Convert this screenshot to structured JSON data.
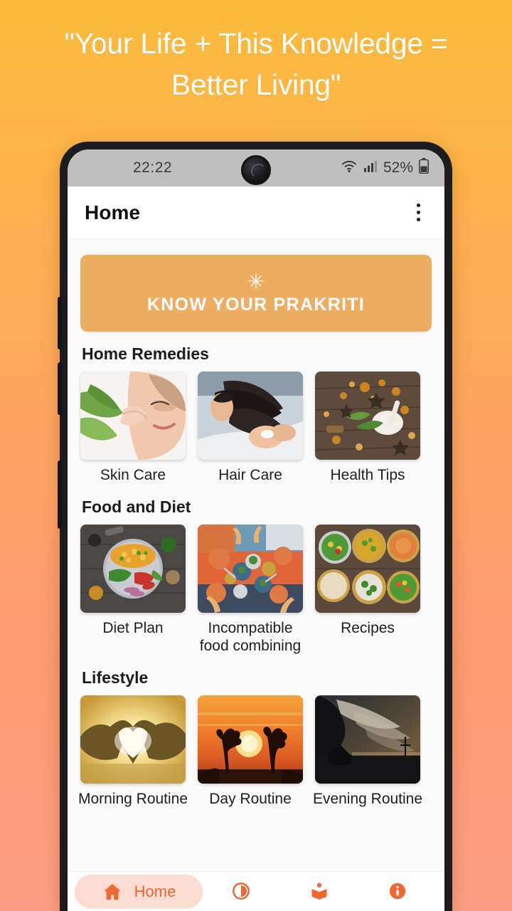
{
  "headline": "\"Your Life + This Knowledge = Better Living\"",
  "colors": {
    "bg_top": "#FCBB39",
    "bg_bottom": "#FC9E85",
    "accent": "#F1672F",
    "banner": "#EDAE62",
    "nav_pill": "#FBDCD0",
    "phone_frame": "#1D1D1F"
  },
  "status_bar": {
    "time": "22:22",
    "wifi_icon": "wifi-icon",
    "signal_icon": "cellular-signal-icon",
    "battery_percent": "52%",
    "battery_icon": "battery-icon",
    "camera": "front-camera"
  },
  "app_bar": {
    "title": "Home",
    "overflow_icon": "more-vert-icon"
  },
  "banner": {
    "icon": "asterisk-flower-icon",
    "glyph": "✳",
    "label": "KNOW YOUR PRAKRITI"
  },
  "sections": [
    {
      "title": "Home Remedies",
      "tiles": [
        {
          "label": "Skin Care",
          "image": "woman-applying-aloe-vera-skincare"
        },
        {
          "label": "Hair Care",
          "image": "woman-hair-wash-salon"
        },
        {
          "label": "Health Tips",
          "image": "herbs-spices-mortar-pestle"
        }
      ]
    },
    {
      "title": "Food and Diet",
      "tiles": [
        {
          "label": "Diet Plan",
          "image": "indian-thali-platter-top-view"
        },
        {
          "label": "Incompatible food combining",
          "image": "people-sharing-meal-table"
        },
        {
          "label": "Recipes",
          "image": "assorted-curry-bowls-wooden-table"
        }
      ]
    },
    {
      "title": "Lifestyle",
      "tiles": [
        {
          "label": "Morning Routine",
          "image": "hands-heart-shape-sunrise"
        },
        {
          "label": "Day Routine",
          "image": "sunset-trees-silhouette"
        },
        {
          "label": "Evening Routine",
          "image": "dusk-house-silhouette-clouds"
        }
      ]
    }
  ],
  "bottom_nav": [
    {
      "label": "Home",
      "icon": "home-icon",
      "active": true
    },
    {
      "label": "",
      "icon": "dosha-circle-icon",
      "active": false
    },
    {
      "label": "",
      "icon": "reading-book-icon",
      "active": false
    },
    {
      "label": "",
      "icon": "info-icon",
      "active": false
    }
  ]
}
